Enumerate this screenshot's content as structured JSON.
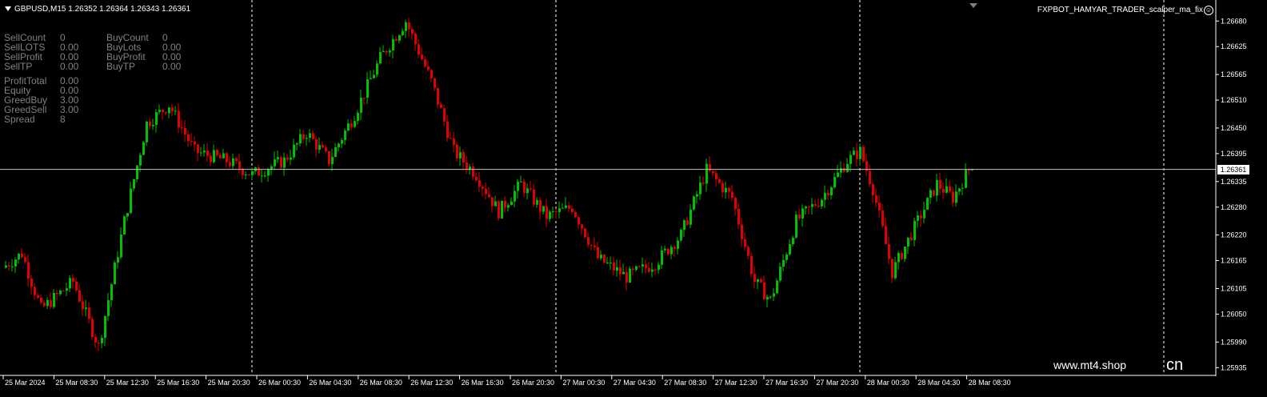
{
  "symbol": {
    "text": "GBPUSD,M15  1.26352 1.26364 1.26343 1.26361"
  },
  "expert": {
    "name": "FXPBOT_HAMYAR_TRADER_scalper_ma_fix",
    "face_icon": "smiley-icon"
  },
  "stats": {
    "sell": [
      {
        "label": "SellCount",
        "value": "0"
      },
      {
        "label": "SellLOTS",
        "value": "0.00"
      },
      {
        "label": "SellProfit",
        "value": "0.00"
      },
      {
        "label": "SellTP",
        "value": "0.00"
      }
    ],
    "buy": [
      {
        "label": "BuyCount",
        "value": "0"
      },
      {
        "label": "BuyLots",
        "value": "0.00"
      },
      {
        "label": "BuyProfit",
        "value": "0.00"
      },
      {
        "label": "BuyTP",
        "value": "0.00"
      }
    ],
    "extra": [
      {
        "label": "ProfitTotal",
        "value": "0.00"
      },
      {
        "label": "Equity",
        "value": "0.00"
      },
      {
        "label": "GreedBuy",
        "value": "3.00"
      },
      {
        "label": "GreedSell",
        "value": "3.00"
      },
      {
        "label": "Spread",
        "value": "8"
      }
    ]
  },
  "price_axis": {
    "labels": [
      "1.26680",
      "1.26625",
      "1.26565",
      "1.26510",
      "1.26450",
      "1.26395",
      "1.26335",
      "1.26280",
      "1.26220",
      "1.26165",
      "1.26105",
      "1.26050",
      "1.25990",
      "1.25935"
    ],
    "current_bid": "1.26361"
  },
  "time_axis": {
    "labels": [
      "25 Mar 2024",
      "25 Mar 08:30",
      "25 Mar 12:30",
      "25 Mar 16:30",
      "25 Mar 20:30",
      "26 Mar 00:30",
      "26 Mar 04:30",
      "26 Mar 08:30",
      "26 Mar 12:30",
      "26 Mar 16:30",
      "26 Mar 20:30",
      "27 Mar 00:30",
      "27 Mar 04:30",
      "27 Mar 08:30",
      "27 Mar 12:30",
      "27 Mar 16:30",
      "27 Mar 20:30",
      "28 Mar 00:30",
      "28 Mar 04:30",
      "28 Mar 08:30"
    ]
  },
  "watermark": {
    "text": "www.mt4.shop",
    "tail": "cn"
  },
  "colors": {
    "bull": "#00c000",
    "bear": "#e00000",
    "grid": "#ffffff",
    "bid_line": "#c0c0c0"
  },
  "chart_data": {
    "type": "candlestick",
    "title": "GBPUSD,M15",
    "ylim": [
      1.2592,
      1.2672
    ],
    "bid": 1.26361,
    "anchors": [
      [
        0,
        1.2615
      ],
      [
        6,
        1.2618
      ],
      [
        12,
        1.2606
      ],
      [
        22,
        1.2612
      ],
      [
        30,
        1.2598
      ],
      [
        38,
        1.2625
      ],
      [
        45,
        1.2646
      ],
      [
        52,
        1.265
      ],
      [
        60,
        1.264
      ],
      [
        70,
        1.2638
      ],
      [
        78,
        1.2635
      ],
      [
        88,
        1.2638
      ],
      [
        95,
        1.2644
      ],
      [
        102,
        1.2638
      ],
      [
        110,
        1.2648
      ],
      [
        118,
        1.266
      ],
      [
        126,
        1.2668
      ],
      [
        134,
        1.2655
      ],
      [
        141,
        1.264
      ],
      [
        148,
        1.2635
      ],
      [
        155,
        1.2627
      ],
      [
        162,
        1.2633
      ],
      [
        170,
        1.2626
      ],
      [
        178,
        1.2628
      ],
      [
        186,
        1.2617
      ],
      [
        195,
        1.2613
      ],
      [
        204,
        1.2616
      ],
      [
        212,
        1.2622
      ],
      [
        220,
        1.2636
      ],
      [
        228,
        1.263
      ],
      [
        235,
        1.2612
      ],
      [
        240,
        1.2608
      ],
      [
        248,
        1.2625
      ],
      [
        256,
        1.263
      ],
      [
        264,
        1.2638
      ],
      [
        268,
        1.264
      ],
      [
        272,
        1.2632
      ],
      [
        278,
        1.2614
      ],
      [
        286,
        1.2625
      ],
      [
        292,
        1.2633
      ],
      [
        297,
        1.263
      ],
      [
        302,
        1.2636
      ]
    ]
  }
}
